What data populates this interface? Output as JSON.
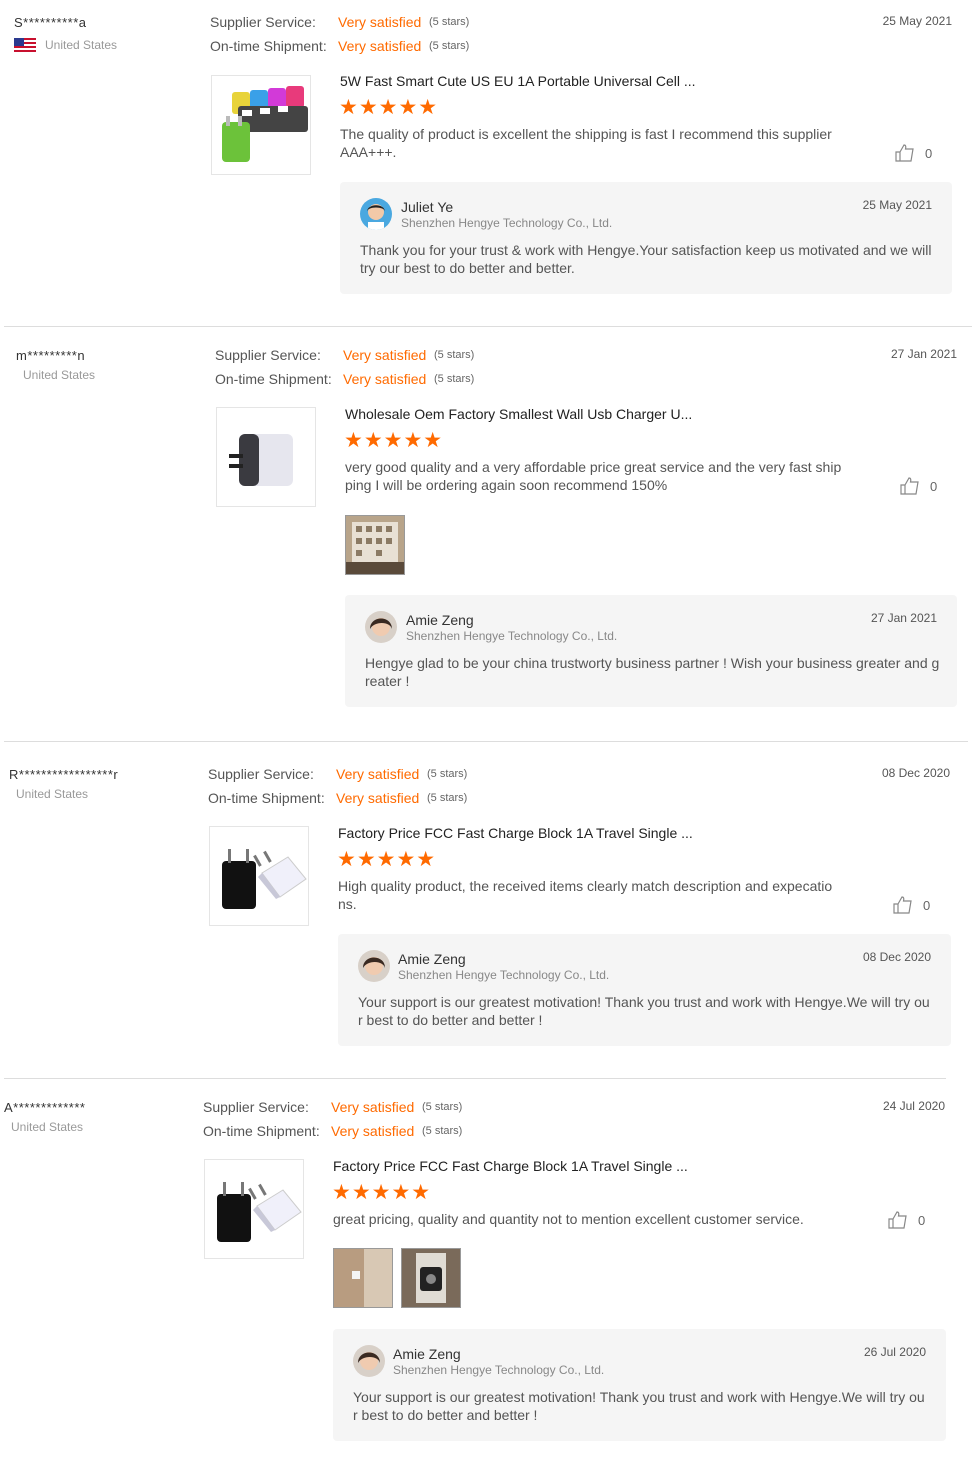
{
  "labels": {
    "supplier_service": "Supplier Service:",
    "ontime_shipment": "On-time Shipment:"
  },
  "colors": {
    "accent": "#ff6a00",
    "reply_bg": "#f5f5f5"
  },
  "reviews": [
    {
      "buyer": "S**********a",
      "country": "United States",
      "has_flag": true,
      "supplier_service": "Very satisfied",
      "supplier_stars": "(5 stars)",
      "ontime": "Very satisfied",
      "ontime_stars": "(5 stars)",
      "date": "25 May 2021",
      "product": "5W Fast Smart Cute US EU 1A Portable Universal Cell ...",
      "rating": "★★★★★",
      "comment": "The quality of product is excellent the shipping is fast I recommend this supplier AAA+++.",
      "likes": "0",
      "reply": {
        "name": "Juliet Ye",
        "company": "Shenzhen Hengye Technology Co., Ltd.",
        "date": "25 May 2021",
        "text": "Thank you for your trust & work with Hengye.Your satisfaction keep us motivated and we will try our best to do better and better."
      }
    },
    {
      "buyer": "m*********n",
      "country": "United States",
      "has_flag": false,
      "supplier_service": "Very satisfied",
      "supplier_stars": "(5 stars)",
      "ontime": "Very satisfied",
      "ontime_stars": "(5 stars)",
      "date": "27 Jan 2021",
      "product": "Wholesale Oem Factory Smallest Wall Usb Charger U...",
      "rating": "★★★★★",
      "comment": "very good quality and a very affordable price great service and the very fast shipping I will be ordering again soon recommend 150%",
      "likes": "0",
      "reply": {
        "name": "Amie Zeng",
        "company": "Shenzhen Hengye Technology Co., Ltd.",
        "date": "27 Jan 2021",
        "text": "Hengye glad to be your china trustworty business partner ! Wish your business greater and greater !"
      }
    },
    {
      "buyer": "R*****************r",
      "country": "United States",
      "has_flag": false,
      "supplier_service": "Very satisfied",
      "supplier_stars": "(5 stars)",
      "ontime": "Very satisfied",
      "ontime_stars": "(5 stars)",
      "date": "08 Dec 2020",
      "product": "Factory Price FCC Fast Charge Block 1A Travel Single ...",
      "rating": "★★★★★",
      "comment": "High quality product, the received items clearly match description and expecations.",
      "likes": "0",
      "reply": {
        "name": "Amie Zeng",
        "company": "Shenzhen Hengye Technology Co., Ltd.",
        "date": "08 Dec 2020",
        "text": "Your support is our greatest motivation! Thank you trust and work with Hengye.We will try our best to do better and better !"
      }
    },
    {
      "buyer": "A*************",
      "country": "United States",
      "has_flag": false,
      "supplier_service": "Very satisfied",
      "supplier_stars": "(5 stars)",
      "ontime": "Very satisfied",
      "ontime_stars": "(5 stars)",
      "date": "24 Jul 2020",
      "product": "Factory Price FCC Fast Charge Block 1A Travel Single ...",
      "rating": "★★★★★",
      "comment": "great pricing, quality and quantity not to mention excellent customer service.",
      "likes": "0",
      "reply": {
        "name": "Amie Zeng",
        "company": "Shenzhen Hengye Technology Co., Ltd.",
        "date": "26 Jul 2020",
        "text": "Your support is our greatest motivation! Thank you trust and work with Hengye.We will try our best to do better and better !"
      }
    }
  ]
}
